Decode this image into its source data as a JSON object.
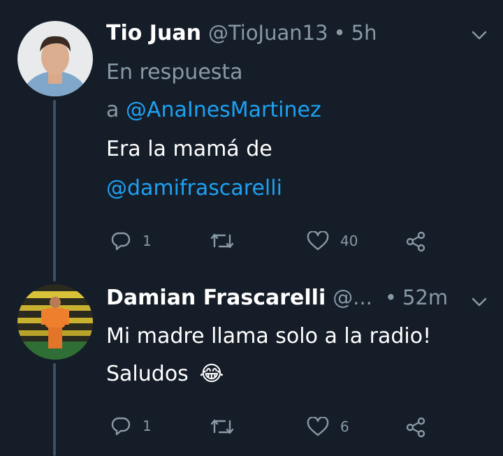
{
  "tweets": [
    {
      "author": "Tio Juan",
      "handle": "@TioJuan13",
      "separator": "•",
      "time": "5h",
      "reply_prefix": "En respuesta",
      "reply_to_prefix": "a ",
      "reply_to": "@AnaInesMartinez",
      "text_line1": "Era la mamá de",
      "text_mention": "@damifrascarelli",
      "reply_count": "1",
      "retweet_count": "",
      "like_count": "40"
    },
    {
      "author": "Damian Frascarelli",
      "handle": "@...",
      "separator": "•",
      "time": "52m",
      "text_line1": "Mi madre llama solo a la radio!",
      "text_line2": "Saludos",
      "emoji": "😂",
      "reply_count": "1",
      "retweet_count": "",
      "like_count": "6"
    }
  ],
  "colors": {
    "background": "#151d28",
    "accent": "#1da1f2",
    "muted": "#8899a6",
    "thread_line": "#3d4f63"
  },
  "icons": [
    "reply-icon",
    "retweet-icon",
    "like-icon",
    "share-icon",
    "chevron-down-icon"
  ]
}
